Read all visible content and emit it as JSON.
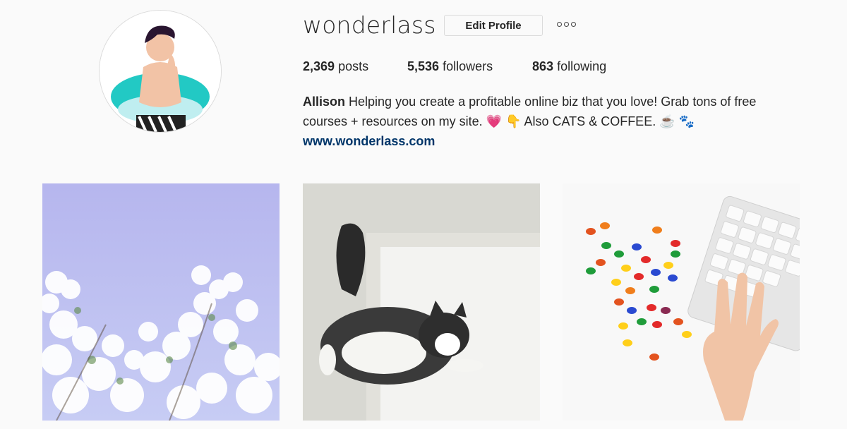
{
  "profile": {
    "username": "wonderlass",
    "edit_button_label": "Edit Profile",
    "more_icon": "ellipsis-icon"
  },
  "stats": {
    "posts_count": "2,369",
    "posts_label": "posts",
    "followers_count": "5,536",
    "followers_label": "followers",
    "following_count": "863",
    "following_label": "following"
  },
  "bio": {
    "name": "Allison",
    "text_line1": "Helping you create a profitable online biz that you love! Grab tons of free",
    "text_line2_a": "courses + resources on my site.",
    "heart_emoji": "💗",
    "point_emoji": "👇",
    "text_line2_b": "Also CATS & COFFEE.",
    "coffee_emoji": "☕",
    "paws_emoji": "🐾",
    "website": "www.wonderlass.com"
  },
  "colors": {
    "background": "#fafafa",
    "text": "#262626",
    "link": "#003569",
    "border": "#dbdbdb"
  },
  "posts": [
    {
      "subject": "white flowering branches against blue sky"
    },
    {
      "subject": "fluffy cat lying in white box"
    },
    {
      "subject": "jelly beans next to keyboard with hand"
    }
  ]
}
